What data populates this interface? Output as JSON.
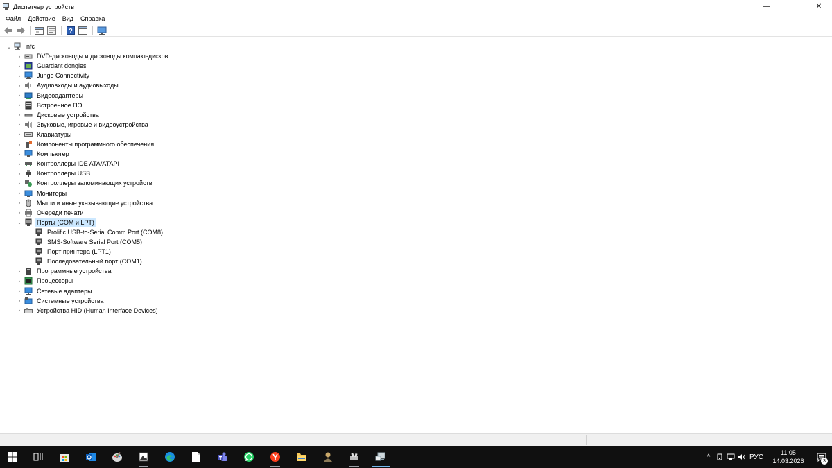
{
  "window": {
    "title": "Диспетчер устройств",
    "controls": {
      "minimize": "—",
      "restore": "❐",
      "close": "✕"
    }
  },
  "menu": [
    "Файл",
    "Действие",
    "Вид",
    "Справка"
  ],
  "toolbar": {
    "buttons": [
      "back-icon",
      "forward-icon",
      "show-hidden-icon",
      "properties-icon",
      "help-icon",
      "details-view-icon",
      "scan-hardware-icon"
    ]
  },
  "tree": {
    "root": {
      "label": "nfc",
      "expand": "⌄"
    },
    "categories": [
      {
        "label": "DVD-дисководы и дисководы компакт-дисков",
        "icon": "dvd-drive-icon",
        "expand": "›"
      },
      {
        "label": "Guardant dongles",
        "icon": "dongle-icon",
        "expand": "›"
      },
      {
        "label": "Jungo Connectivity",
        "icon": "connectivity-icon",
        "expand": "›"
      },
      {
        "label": "Аудиовходы и аудиовыходы",
        "icon": "audio-icon",
        "expand": "›"
      },
      {
        "label": "Видеоадаптеры",
        "icon": "display-adapter-icon",
        "expand": "›"
      },
      {
        "label": "Встроенное ПО",
        "icon": "firmware-icon",
        "expand": "›"
      },
      {
        "label": "Дисковые устройства",
        "icon": "disk-drive-icon",
        "expand": "›"
      },
      {
        "label": "Звуковые, игровые и видеоустройства",
        "icon": "sound-icon",
        "expand": "›"
      },
      {
        "label": "Клавиатуры",
        "icon": "keyboard-icon",
        "expand": "›"
      },
      {
        "label": "Компоненты программного обеспечения",
        "icon": "software-component-icon",
        "expand": "›"
      },
      {
        "label": "Компьютер",
        "icon": "computer-icon",
        "expand": "›"
      },
      {
        "label": "Контроллеры IDE ATA/ATAPI",
        "icon": "ide-controller-icon",
        "expand": "›"
      },
      {
        "label": "Контроллеры USB",
        "icon": "usb-icon",
        "expand": "›"
      },
      {
        "label": "Контроллеры запоминающих устройств",
        "icon": "storage-controller-icon",
        "expand": "›"
      },
      {
        "label": "Мониторы",
        "icon": "monitor-icon",
        "expand": "›"
      },
      {
        "label": "Мыши и иные указывающие устройства",
        "icon": "mouse-icon",
        "expand": "›"
      },
      {
        "label": "Очереди печати",
        "icon": "printer-icon",
        "expand": "›"
      },
      {
        "label": "Порты (COM и LPT)",
        "icon": "port-icon",
        "expand": "⌄",
        "selected": true,
        "children": [
          {
            "label": "Prolific USB-to-Serial Comm Port (COM8)",
            "icon": "port-icon"
          },
          {
            "label": "SMS-Software Serial Port (COM5)",
            "icon": "port-icon"
          },
          {
            "label": "Порт принтера (LPT1)",
            "icon": "port-icon"
          },
          {
            "label": "Последовательный порт (COM1)",
            "icon": "port-icon"
          }
        ]
      },
      {
        "label": "Программные устройства",
        "icon": "software-device-icon",
        "expand": "›"
      },
      {
        "label": "Процессоры",
        "icon": "processor-icon",
        "expand": "›"
      },
      {
        "label": "Сетевые адаптеры",
        "icon": "network-adapter-icon",
        "expand": "›"
      },
      {
        "label": "Системные устройства",
        "icon": "system-device-icon",
        "expand": "›"
      },
      {
        "label": "Устройства HID (Human Interface Devices)",
        "icon": "hid-icon",
        "expand": "›"
      }
    ]
  },
  "taskbar": {
    "apps": [
      {
        "icon": "start-icon"
      },
      {
        "icon": "task-view-icon"
      },
      {
        "icon": "store-icon"
      },
      {
        "icon": "outlook-icon"
      },
      {
        "icon": "paint-icon"
      },
      {
        "icon": "photo-app-icon",
        "state": "running"
      },
      {
        "icon": "edge-icon"
      },
      {
        "icon": "file-icon"
      },
      {
        "icon": "teams-icon"
      },
      {
        "icon": "whatsapp-icon"
      },
      {
        "icon": "yandex-icon",
        "state": "running"
      },
      {
        "icon": "explorer-icon"
      },
      {
        "icon": "app-user-icon"
      },
      {
        "icon": "app-tool-icon",
        "state": "running"
      },
      {
        "icon": "device-manager-icon",
        "state": "active"
      }
    ],
    "tray": {
      "chevron": "^",
      "language": "РУС",
      "time": "11:05",
      "date": "14.03.2026",
      "notifications": "3"
    }
  },
  "colors": {
    "selection": "#cce8ff",
    "taskbar": "#101010",
    "accent": "#76b9ed"
  }
}
